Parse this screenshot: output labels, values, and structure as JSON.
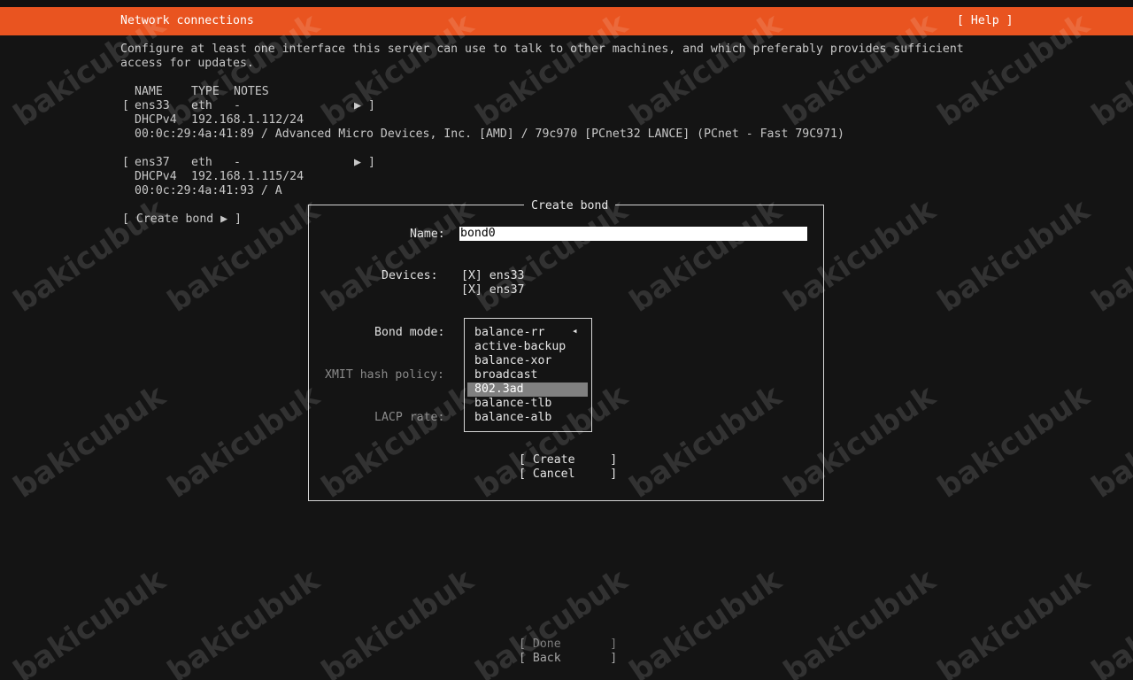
{
  "header": {
    "title": "Network connections",
    "help_label": "[ Help ]"
  },
  "intro": {
    "line1": "Configure at least one interface this server can use to talk to other machines, and which preferably provides sufficient",
    "line2": "access for updates."
  },
  "table": {
    "columns": [
      "NAME",
      "TYPE",
      "NOTES"
    ],
    "interfaces": [
      {
        "name": "ens33",
        "type": "eth",
        "notes": "-",
        "dhcp_label": "DHCPv4",
        "address": "192.168.1.112/24",
        "hw_info": "00:0c:29:4a:41:89 / Advanced Micro Devices, Inc. [AMD] / 79c970 [PCnet32 LANCE] (PCnet - Fast 79C971)"
      },
      {
        "name": "ens37",
        "type": "eth",
        "notes": "-",
        "dhcp_label": "DHCPv4",
        "address": "192.168.1.115/24",
        "hw_info": "00:0c:29:4a:41:93 / A"
      }
    ],
    "bracket_open": "[",
    "bracket_close": "]",
    "arrow": "▶",
    "create_bond_label": "[ Create bond ▶ ]"
  },
  "dialog": {
    "title": "Create bond",
    "name_label": "Name:",
    "name_value": "bond0",
    "devices_label": "Devices:",
    "devices": [
      "[X] ens33",
      "[X] ens37"
    ],
    "bond_mode_label": "Bond mode:",
    "xmit_label": "XMIT hash policy:",
    "lacp_label": "LACP rate:",
    "bond_modes": [
      "balance-rr",
      "active-backup",
      "balance-xor",
      "broadcast",
      "802.3ad",
      "balance-tlb",
      "balance-alb"
    ],
    "selected_mode": "802.3ad",
    "dropdown_indicator": "◂",
    "create_label": "[ Create     ]",
    "cancel_label": "[ Cancel     ]"
  },
  "footer": {
    "done_label": "[ Done       ]",
    "back_label": "[ Back       ]"
  },
  "watermark": "bakicubuk",
  "colors": {
    "header": "#e95420",
    "background": "#141414",
    "highlight": "#808080"
  }
}
